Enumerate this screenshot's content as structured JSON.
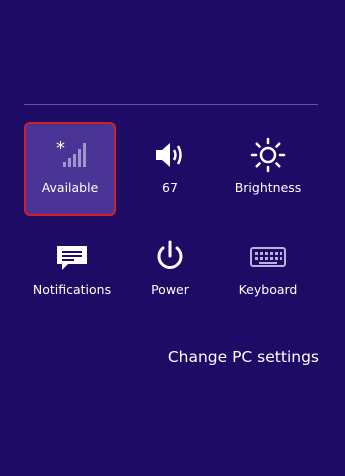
{
  "settings_charm": {
    "tiles": [
      {
        "label": "Available",
        "icon": "network-signal-icon"
      },
      {
        "label": "67",
        "icon": "volume-icon"
      },
      {
        "label": "Brightness",
        "icon": "brightness-sun-icon"
      },
      {
        "label": "Notifications",
        "icon": "notifications-message-icon"
      },
      {
        "label": "Power",
        "icon": "power-icon"
      },
      {
        "label": "Keyboard",
        "icon": "keyboard-icon"
      }
    ],
    "change_pc_settings": "Change PC settings"
  },
  "colors": {
    "background": "#1e0b65",
    "selected_tile": "#4a3495",
    "selection_outline": "#d0202c"
  }
}
